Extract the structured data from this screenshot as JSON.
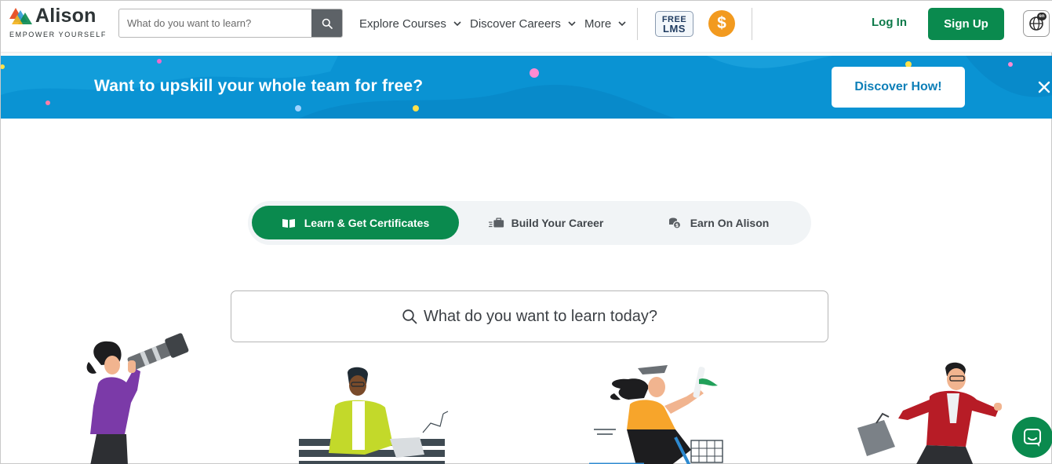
{
  "brand": {
    "name": "Alison",
    "tagline": "EMPOWER YOURSELF",
    "colors": {
      "primary_green": "#0a8a4e",
      "banner_blue": "#0a93d3",
      "coin_orange": "#f29a1f"
    }
  },
  "header": {
    "search_placeholder": "What do you want to learn?",
    "nav": [
      {
        "label": "Explore Courses",
        "icon": "chevron-down-icon"
      },
      {
        "label": "Discover Careers",
        "icon": "chevron-down-icon"
      },
      {
        "label": "More",
        "icon": "chevron-down-icon"
      }
    ],
    "free_lms": {
      "line1": "FREE",
      "line2": "LMS"
    },
    "coin_symbol": "$",
    "login_label": "Log In",
    "signup_label": "Sign Up",
    "language_badge": "en"
  },
  "banner": {
    "text": "Want to upskill your whole team for free?",
    "cta_label": "Discover How!"
  },
  "tabs": [
    {
      "label": "Learn & Get Certificates",
      "icon": "open-book-icon",
      "active": true
    },
    {
      "label": "Build Your Career",
      "icon": "briefcase-icon",
      "active": false
    },
    {
      "label": "Earn On Alison",
      "icon": "coins-icon",
      "active": false
    }
  ],
  "main_search": {
    "placeholder": "What do you want to learn today?"
  }
}
